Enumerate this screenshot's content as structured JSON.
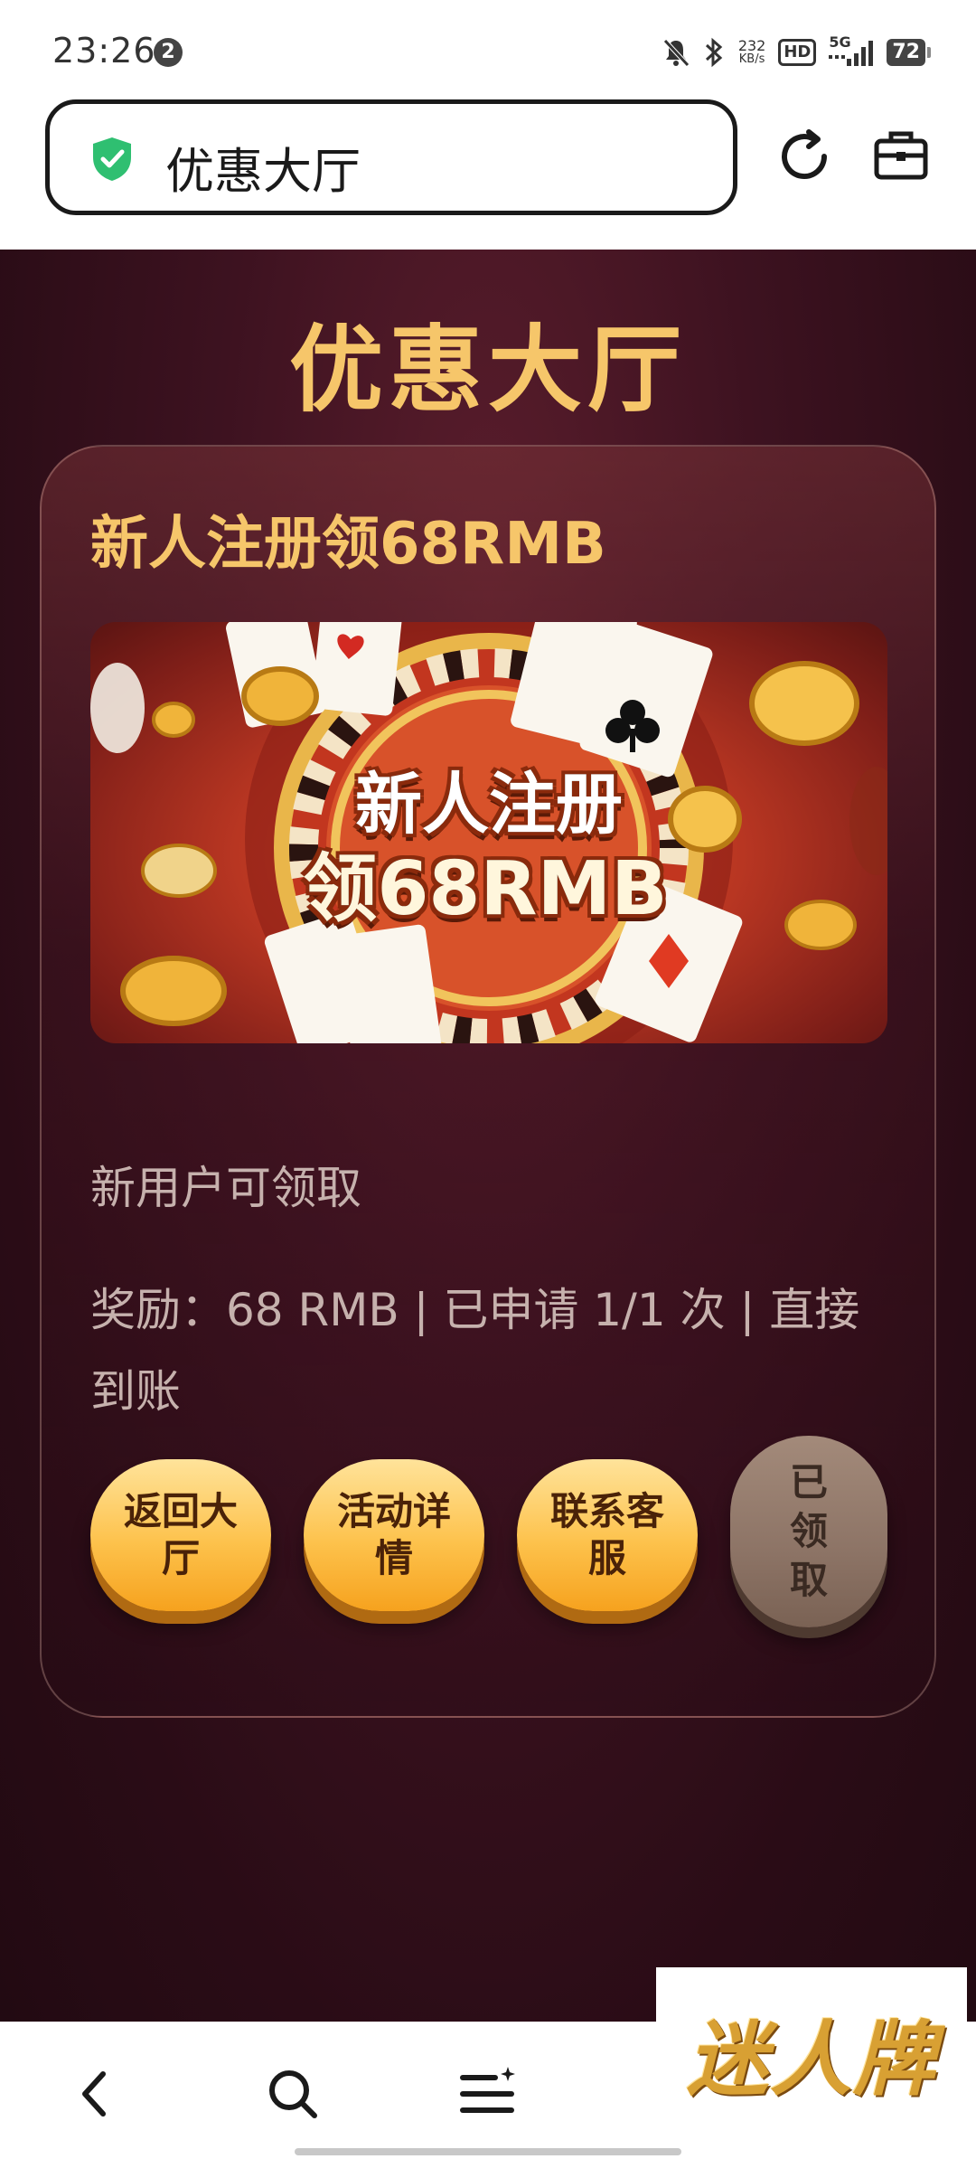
{
  "status_bar": {
    "time": "23:26",
    "notification_count": "2",
    "net_speed_value": "232",
    "net_speed_unit": "KB/s",
    "hd_label": "HD",
    "network_label": "5G",
    "battery": "72"
  },
  "address_bar": {
    "url_text": "优惠大厅"
  },
  "page": {
    "title": "优惠大厅",
    "card": {
      "title": "新人注册领68RMB",
      "banner_line1": "新人注册",
      "banner_line2": "领68RMB",
      "desc_eligibility": "新用户可领取",
      "desc_reward": "奖励：68 RMB | 已申请 1/1 次 | 直接到账",
      "buttons": {
        "back": "返回大厅",
        "detail": "活动详情",
        "service": "联系客服",
        "claimed": "已领取"
      }
    }
  },
  "watermark": "迷人牌",
  "colors": {
    "accent_gold": "#f6c66a",
    "page_bg": "#3d1220",
    "button_gold": "#fdc24c",
    "claimed_gray": "#8d7466",
    "shield_green": "#2fbf71"
  }
}
